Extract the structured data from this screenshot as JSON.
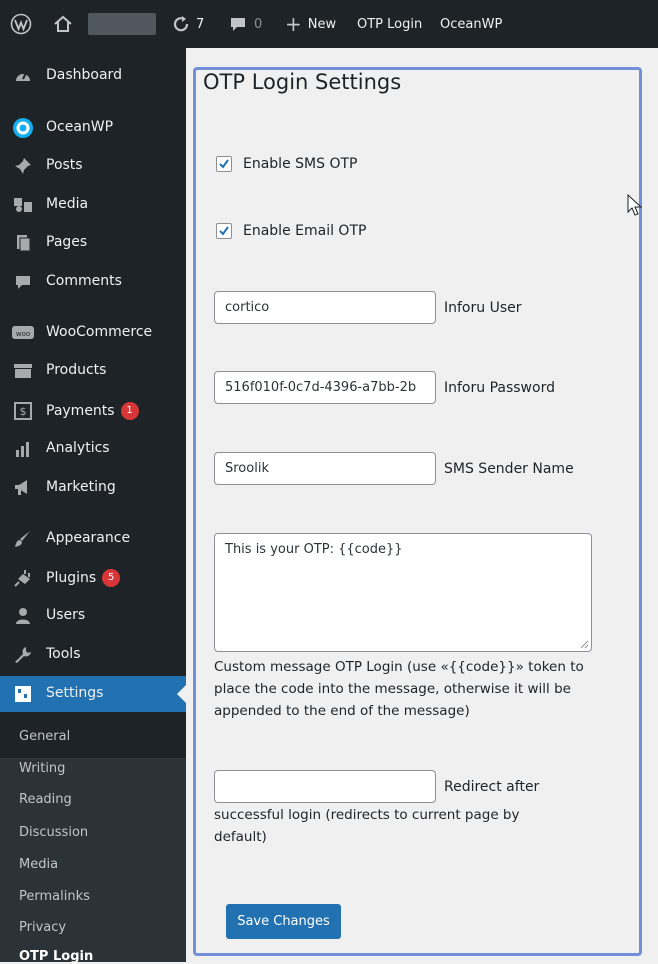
{
  "adminbar": {
    "updates_count": "7",
    "comments_count": "0",
    "new_label": "New",
    "plugin_link": "OTP Login",
    "theme_link": "OceanWP"
  },
  "sidebar": {
    "items": [
      {
        "label": "Dashboard",
        "icon": "dashboard-icon"
      },
      {
        "label": "OceanWP",
        "icon": "oceanwp-icon"
      },
      {
        "label": "Posts",
        "icon": "pin-icon"
      },
      {
        "label": "Media",
        "icon": "media-icon"
      },
      {
        "label": "Pages",
        "icon": "pages-icon"
      },
      {
        "label": "Comments",
        "icon": "comment-icon"
      },
      {
        "label": "WooCommerce",
        "icon": "woo-icon"
      },
      {
        "label": "Products",
        "icon": "archive-icon"
      },
      {
        "label": "Payments",
        "icon": "dollar-icon",
        "badge": "1"
      },
      {
        "label": "Analytics",
        "icon": "bar-chart-icon"
      },
      {
        "label": "Marketing",
        "icon": "megaphone-icon"
      },
      {
        "label": "Appearance",
        "icon": "brush-icon"
      },
      {
        "label": "Plugins",
        "icon": "plug-icon",
        "badge": "5"
      },
      {
        "label": "Users",
        "icon": "user-icon"
      },
      {
        "label": "Tools",
        "icon": "wrench-icon"
      },
      {
        "label": "Settings",
        "icon": "settings-icon"
      }
    ],
    "submenu": [
      "General",
      "Writing",
      "Reading",
      "Discussion",
      "Media",
      "Permalinks",
      "Privacy",
      "OTP Login"
    ]
  },
  "settings": {
    "title": "OTP Login Settings",
    "enable_sms_label": "Enable SMS OTP",
    "enable_sms_checked": true,
    "enable_email_label": "Enable Email OTP",
    "enable_email_checked": true,
    "inforu_user_value": "cortico",
    "inforu_user_label": "Inforu User",
    "inforu_password_value": "516f010f-0c7d-4396-a7bb-2b",
    "inforu_password_label": "Inforu Password",
    "sms_sender_value": "Sroolik",
    "sms_sender_label": "SMS Sender Name",
    "message_value": "This is your OTP: {{code}}",
    "message_desc_line1": "Custom message OTP Login (use «{{code}}» token to",
    "message_desc_line2": "place the code into the message, otherwise it will be",
    "message_desc_line3": "appended to the end of the message)",
    "redirect_value": "",
    "redirect_label": "Redirect after",
    "redirect_desc_line2": "successful login (redirects to current page by",
    "redirect_desc_line3": "default)",
    "save_label": "Save Changes"
  },
  "colors": {
    "accent": "#2271b1",
    "admin_bg": "#1d2327",
    "panel_border": "#7190d8",
    "badge": "#d63638"
  }
}
